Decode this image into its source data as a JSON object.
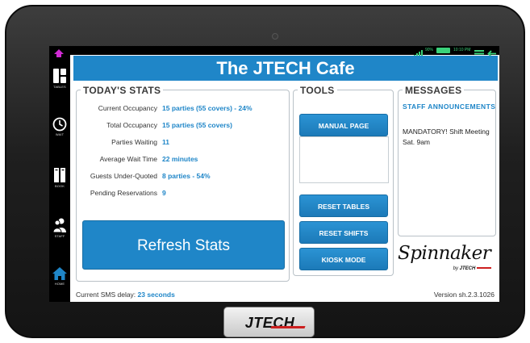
{
  "app": {
    "title": "The JTECH Cafe"
  },
  "statusbar": {
    "signal_text": "90%",
    "time": "10:10 PM"
  },
  "sidebar": {
    "items": [
      {
        "label": "TABLES",
        "icon": "tables-icon"
      },
      {
        "label": "WAIT",
        "icon": "clock-icon"
      },
      {
        "label": "BOOK",
        "icon": "book-icon"
      },
      {
        "label": "STAFF",
        "icon": "staff-icon"
      },
      {
        "label": "HOME",
        "icon": "home-icon"
      }
    ]
  },
  "stats": {
    "title": "TODAY'S STATS",
    "rows": [
      {
        "label": "Current Occupancy",
        "value": "15 parties (55 covers) - 24%"
      },
      {
        "label": "Total Occupancy",
        "value": "15 parties (55 covers)"
      },
      {
        "label": "Parties Waiting",
        "value": "11"
      },
      {
        "label": "Average Wait Time",
        "value": "22 minutes"
      },
      {
        "label": "Guests Under-Quoted",
        "value": "8 parties - 54%"
      },
      {
        "label": "Pending Reservations",
        "value": "9"
      }
    ],
    "refresh_label": "Refresh Stats"
  },
  "tools": {
    "title": "TOOLS",
    "buttons": {
      "manual_page": "MANUAL PAGE",
      "reset_tables": "RESET TABLES",
      "reset_shifts": "RESET SHIFTS",
      "kiosk_mode": "KIOSK MODE"
    }
  },
  "messages": {
    "title": "MESSAGES",
    "heading": "STAFF ANNOUNCEMENTS",
    "body": "MANDATORY! Shift Meeting Sat. 9am"
  },
  "branding": {
    "spinnaker": "Spinnaker",
    "by": "by",
    "jtech_small": "JTECH",
    "bezel_logo": "JTECH"
  },
  "footer": {
    "sms_label": "Current SMS delay:",
    "sms_value": "23 seconds",
    "version": "Version sh.2.3.1026"
  },
  "colors": {
    "accent": "#1f86c8",
    "sidebar": "#000000",
    "bezel": "#1f1f1f",
    "logo_red": "#cc1f1f",
    "status_green": "#3ad27a"
  }
}
